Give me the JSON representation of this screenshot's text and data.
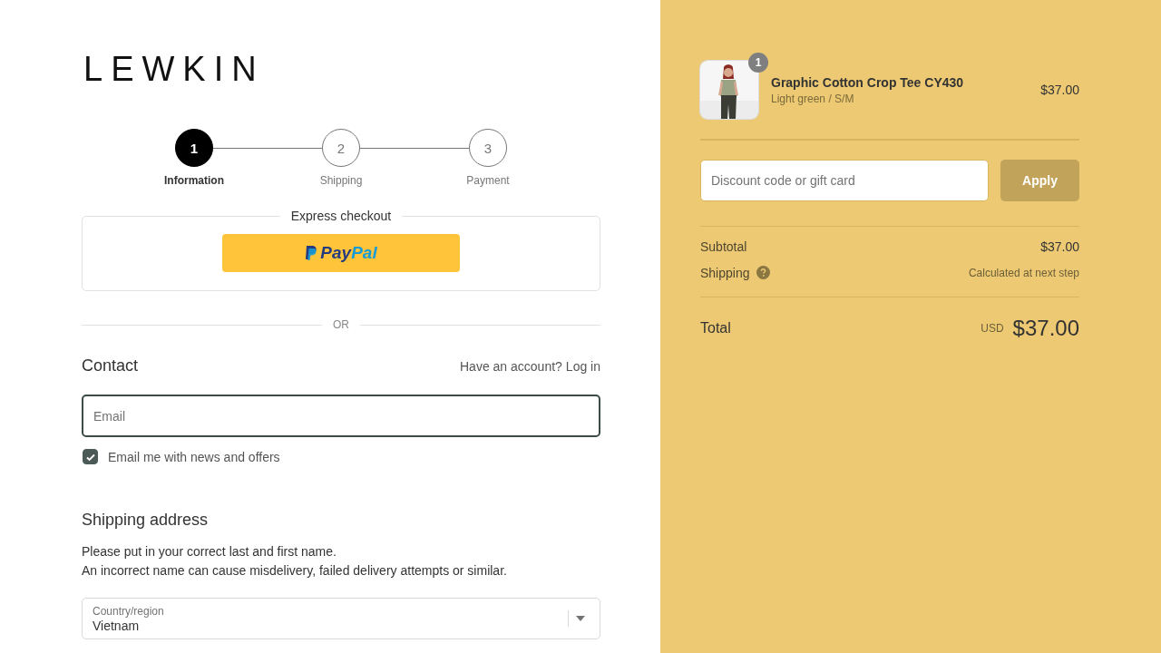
{
  "brand": "LEWKIN",
  "steps": [
    {
      "number": "1",
      "label": "Information",
      "selected": true
    },
    {
      "number": "2",
      "label": "Shipping",
      "selected": false
    },
    {
      "number": "3",
      "label": "Payment",
      "selected": false
    }
  ],
  "express_checkout": {
    "title": "Express checkout",
    "button": {
      "first": "Pay",
      "second": "Pal"
    }
  },
  "divider_text": "OR",
  "contact": {
    "title": "Contact",
    "account_prompt": "Have an account?",
    "login_link": "Log in",
    "email": {
      "placeholder": "Email"
    },
    "newsletter": {
      "label": "Email me with news and offers",
      "checked": true
    }
  },
  "shipping_address": {
    "title": "Shipping address",
    "notes": [
      "Please put in your correct last and first name.",
      "An incorrect name can cause misdelivery, failed delivery attempts or similar."
    ],
    "country": {
      "label": "Country/region",
      "value": "Vietnam"
    }
  },
  "order_summary": {
    "items": [
      {
        "kind": "picture",
        "quantity": "1",
        "name": "Graphic Cotton Crop Tee CY430",
        "variant": "Light green / S/M",
        "price": "$37.00"
      }
    ],
    "discount": {
      "placeholder": "Discount code or gift card",
      "button": "Apply"
    },
    "subtotal": {
      "label": "Subtotal",
      "value": "$37.00"
    },
    "shipping": {
      "label": "Shipping",
      "value": "Calculated at next step"
    },
    "total": {
      "label": "Total",
      "currency": "USD",
      "value": "$37.00"
    }
  }
}
